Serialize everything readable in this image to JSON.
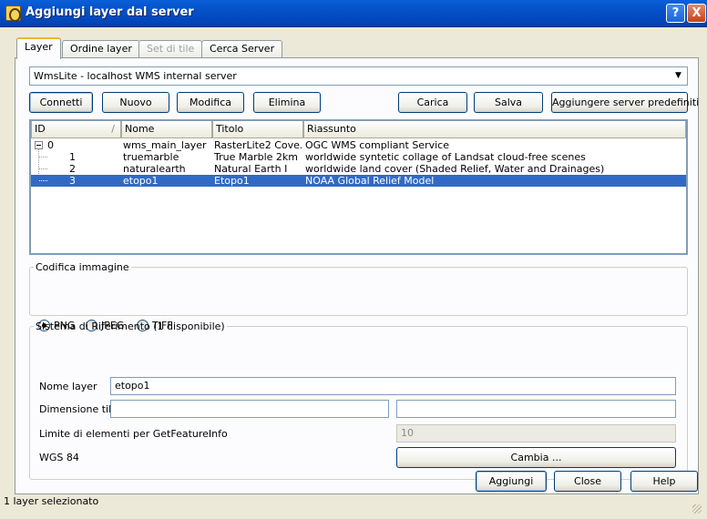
{
  "window": {
    "title": "Aggiungi layer dal server",
    "help_glyph": "?",
    "close_glyph": "X",
    "app_icon": "qgis-icon"
  },
  "tabs": [
    {
      "label": "Layer",
      "active": true
    },
    {
      "label": "Ordine layer",
      "active": false
    },
    {
      "label": "Set di tile",
      "active": false,
      "disabled": true
    },
    {
      "label": "Cerca Server",
      "active": false
    }
  ],
  "server_combo": {
    "value": "WmsLite - localhost WMS internal server",
    "arrow": "▼"
  },
  "buttons": {
    "connect": "Connetti",
    "new": "Nuovo",
    "edit": "Modifica",
    "delete": "Elimina",
    "load": "Carica",
    "save": "Salva",
    "add_default": "Aggiungere server predefiniti"
  },
  "tree": {
    "columns": [
      "ID",
      "Nome",
      "Titolo",
      "Riassunto"
    ],
    "sort_glyph": "/",
    "rows": [
      {
        "id": "0",
        "name": "wms_main_layer",
        "title": "RasterLite2 Cove...",
        "abstract": "OGC WMS compliant Service",
        "selected": false
      },
      {
        "id": "1",
        "name": "truemarble",
        "title": "True Marble 2km",
        "abstract": "worldwide syntetic collage of Landsat cloud-free scenes",
        "selected": false
      },
      {
        "id": "2",
        "name": "naturalearth",
        "title": "Natural Earth I",
        "abstract": "worldwide land cover (Shaded Relief, Water and Drainages)",
        "selected": false
      },
      {
        "id": "3",
        "name": "etopo1",
        "title": "Etopo1",
        "abstract": "NOAA Global Relief Model",
        "selected": true
      }
    ]
  },
  "encoding": {
    "legend": "Codifica immagine",
    "options": [
      "PNG",
      "JPEG",
      "TIFF"
    ],
    "selected": "PNG"
  },
  "crs": {
    "legend": "Sistema di Riferimento (1 disponibile)",
    "layer_name_label": "Nome layer",
    "layer_name_value": "etopo1",
    "tile_size_label": "Dimensione tile",
    "tile_size_w": "",
    "tile_size_h": "",
    "feature_info_label": "Limite di elementi per GetFeatureInfo",
    "feature_info_placeholder": "10",
    "crs_name": "WGS 84",
    "change_button": "Cambia ..."
  },
  "footer": {
    "add": "Aggiungi",
    "close": "Close",
    "help": "Help"
  },
  "status": "1 layer selezionato"
}
